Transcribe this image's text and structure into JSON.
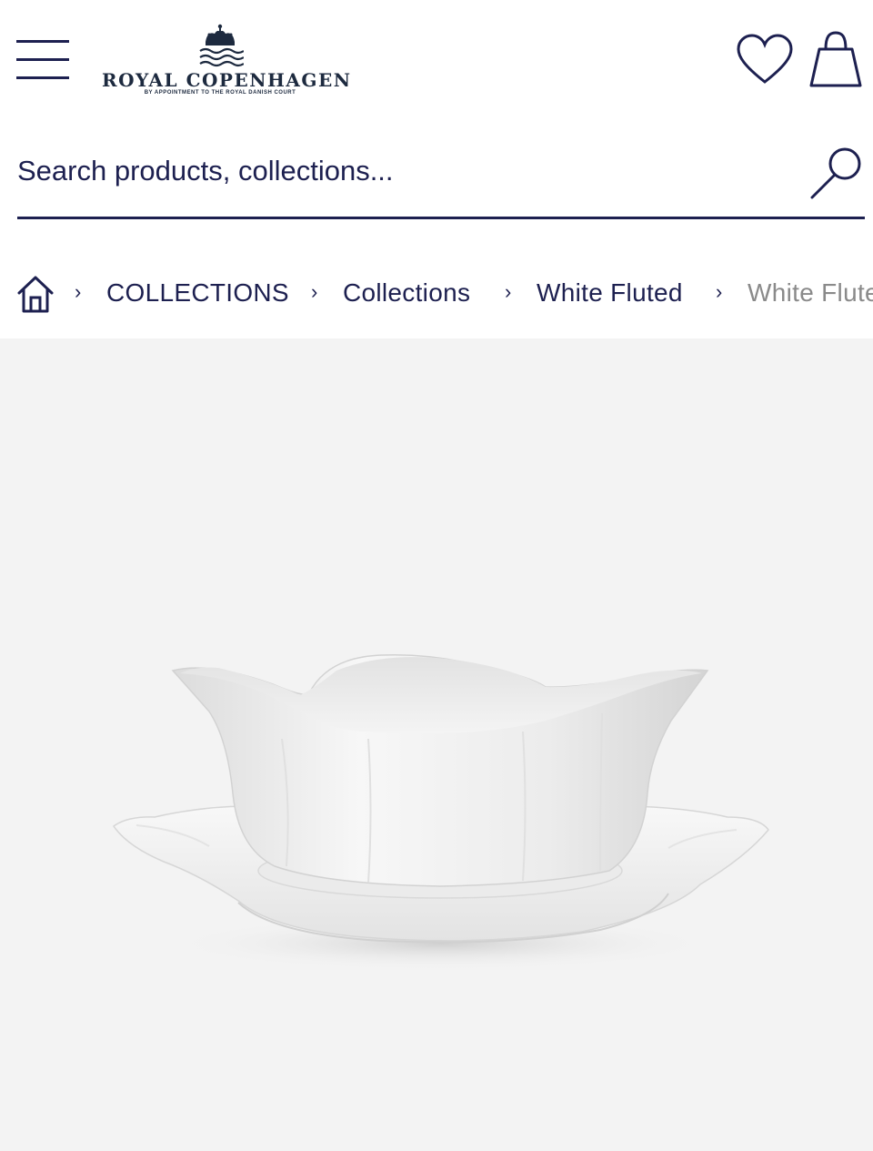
{
  "header": {
    "menu_icon": "hamburger-menu-icon",
    "logo": {
      "brand": "ROYAL COPENHAGEN",
      "tagline": "BY APPOINTMENT TO THE ROYAL DANISH COURT"
    },
    "wishlist_icon": "heart-icon",
    "bag_icon": "shopping-bag-icon"
  },
  "search": {
    "placeholder": "Search products, collections...",
    "value": "",
    "icon": "search-icon"
  },
  "breadcrumb": {
    "home_icon": "home-icon",
    "items": [
      {
        "label": "COLLECTIONS"
      },
      {
        "label": "Collections"
      },
      {
        "label": "White Fluted"
      },
      {
        "label": "White Fluted"
      }
    ]
  },
  "product": {
    "image_subject": "white fluted porcelain sauce boat on saucer",
    "background_color": "#f3f3f3"
  },
  "colors": {
    "brand_navy": "#1d2050",
    "muted_text": "#8a8a8a"
  }
}
